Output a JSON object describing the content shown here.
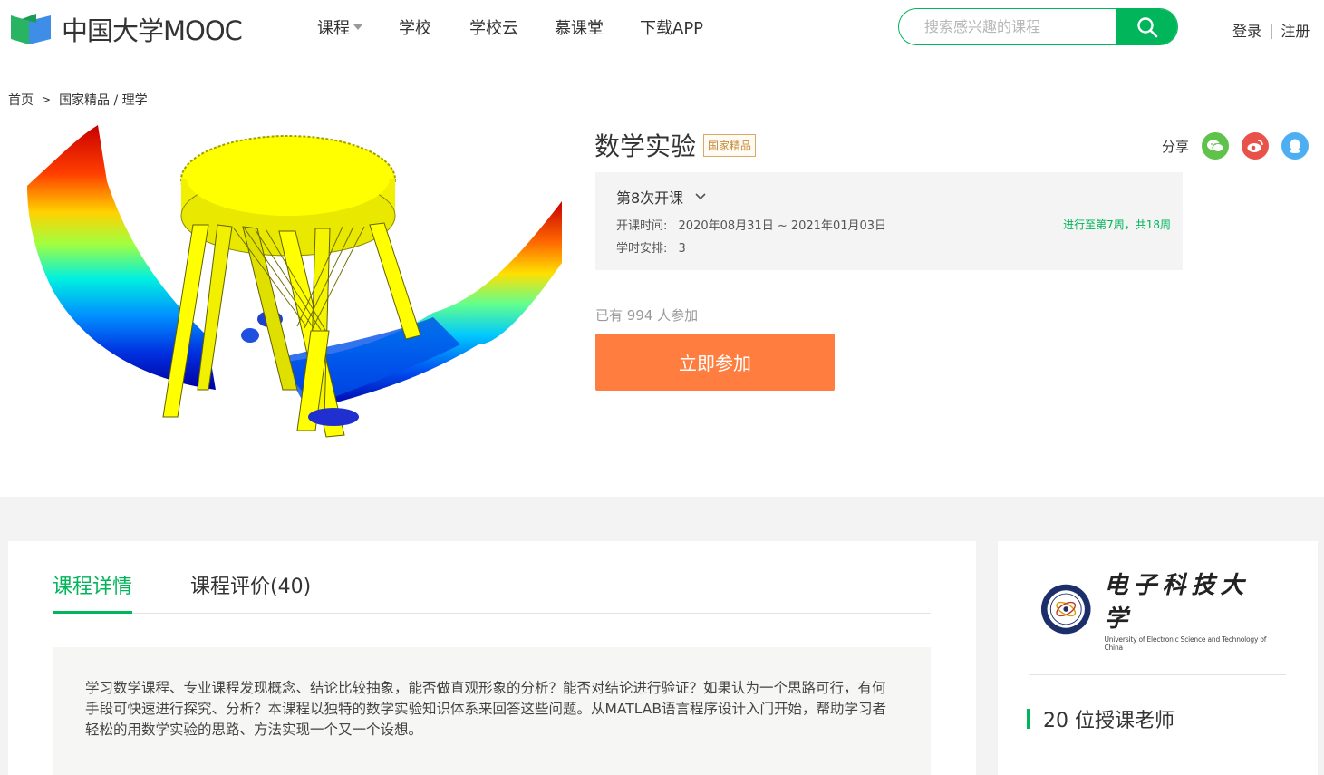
{
  "header": {
    "logo_text": "中国大学MOOC",
    "nav": [
      "课程",
      "学校",
      "学校云",
      "慕课堂",
      "下载APP"
    ],
    "search_placeholder": "搜索感兴趣的课程",
    "login": "登录",
    "separator": "|",
    "register": "注册",
    "brand_color": "#00b55a"
  },
  "breadcrumb": {
    "home": "首页",
    "arrow": ">",
    "path": "国家精品 / 理学"
  },
  "course": {
    "title": "数学实验",
    "badge": "国家精品",
    "share_label": "分享",
    "share_icons": [
      "wechat-icon",
      "weibo-icon",
      "qq-icon"
    ],
    "term": "第8次开课",
    "time_label": "开课时间:",
    "time_value": "2020年08月31日 ~ 2021年01月03日",
    "hours_label": "学时安排:",
    "hours_value": "3",
    "progress": "进行至第7周，共18周",
    "enroll_count": "已有 994 人参加",
    "join_button": "立即参加",
    "join_color": "#ff7d3f"
  },
  "tabs": {
    "detail": "课程详情",
    "reviews": "课程评价(40)"
  },
  "description": "学习数学课程、专业课程发现概念、结论比较抽象，能否做直观形象的分析？能否对结论进行验证？如果认为一个思路可行，有何手段可快速进行探究、分析？本课程以独特的数学实验知识体系来回答这些问题。从MATLAB语言程序设计入门开始，帮助学习者轻松的用数学实验的思路、方法实现一个又一个设想。",
  "sidebar": {
    "university_cn": "电子科技大学",
    "university_en": "University of Electronic Science and Technology of China",
    "teachers": "20 位授课老师"
  }
}
